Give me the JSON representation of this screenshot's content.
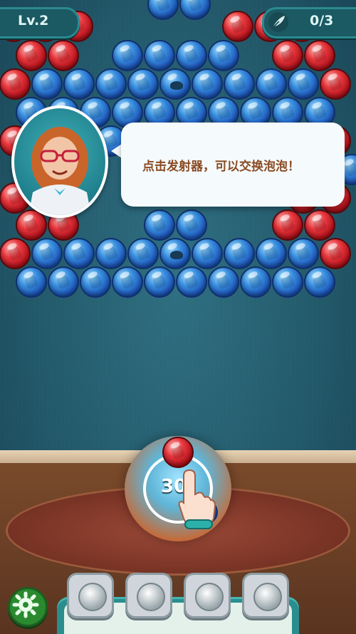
{
  "hud": {
    "level": "Lv.2",
    "feathers": "0/3"
  },
  "tutorial": {
    "message": "点击发射器，可以交换泡泡！"
  },
  "shooter": {
    "count": "30",
    "current_bubble_color": "red",
    "next_bubble_color": "blue"
  },
  "boosters": [
    {
      "name": "booster-1",
      "icon": "paint-bottle-icon"
    },
    {
      "name": "booster-2",
      "icon": "yarn-ball-icon"
    },
    {
      "name": "booster-3",
      "icon": "rocket-icon"
    },
    {
      "name": "booster-4",
      "icon": "flower-bomb-icon"
    }
  ],
  "colors": {
    "blue_bubble": "#1d56b8",
    "red_bubble": "#b3121c",
    "hud_teal": "#1b5963"
  }
}
